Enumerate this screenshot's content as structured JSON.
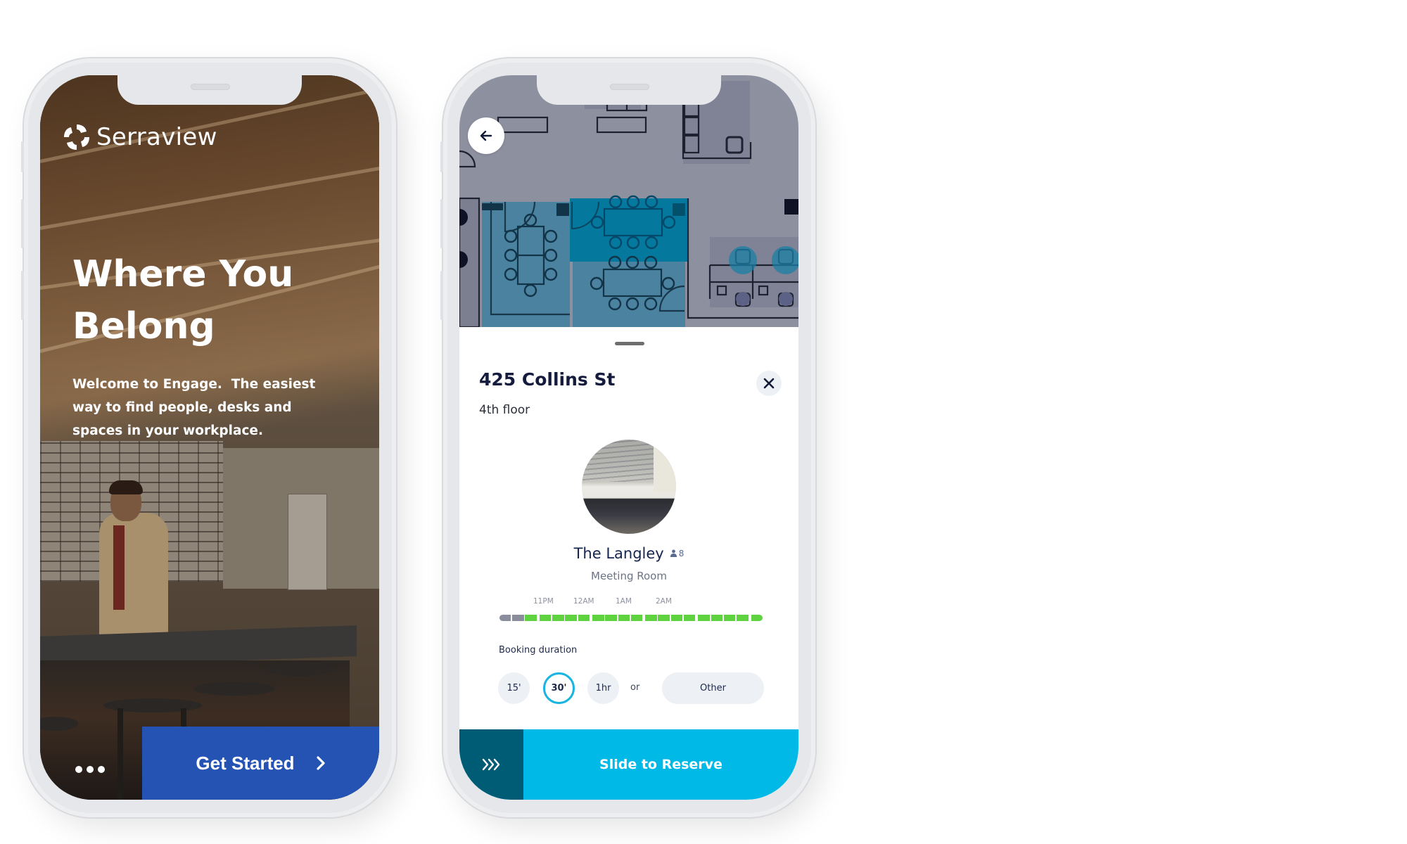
{
  "welcome_screen": {
    "brand": {
      "name": "Serraview",
      "icon": "serraview-logo-icon"
    },
    "hero_title_lines": [
      "Where You",
      "Belong"
    ],
    "hero_text_lines": [
      "Welcome to Engage.  The easiest",
      "way to find people, desks and",
      "spaces in your workplace."
    ],
    "pager": {
      "icon": "more-dots-icon",
      "dots": 3
    },
    "cta": {
      "label": "Get Started",
      "icon": "chevron-right-icon",
      "color": "#2553b4"
    }
  },
  "booking_screen": {
    "back_icon": "arrow-left-icon",
    "location": {
      "title": "425 Collins St",
      "floor": "4th floor",
      "close_icon": "close-icon"
    },
    "room": {
      "name": "The Langley",
      "capacity_icon": "person-icon",
      "capacity": "8",
      "type": "Meeting Room"
    },
    "timeline": {
      "labels": [
        "11PM",
        "12AM",
        "1AM",
        "2AM"
      ],
      "segments": [
        "busy",
        "busy",
        "free",
        "free",
        "free",
        "free",
        "free",
        "free",
        "free",
        "free",
        "free",
        "free",
        "free",
        "free",
        "free",
        "free",
        "free",
        "free",
        "free",
        "free"
      ],
      "colors": {
        "busy": "#8a8d9b",
        "free": "#5fd33f"
      }
    },
    "booking_duration": {
      "label": "Booking duration",
      "options": [
        "15'",
        "30'",
        "1hr"
      ],
      "selected": "30'",
      "or_label": "or",
      "other_label": "Other"
    },
    "slide": {
      "icon": "triple-chevron-right-icon",
      "label": "Slide to Reserve",
      "color": "#00b9e7",
      "handle_color": "#005c75"
    }
  }
}
